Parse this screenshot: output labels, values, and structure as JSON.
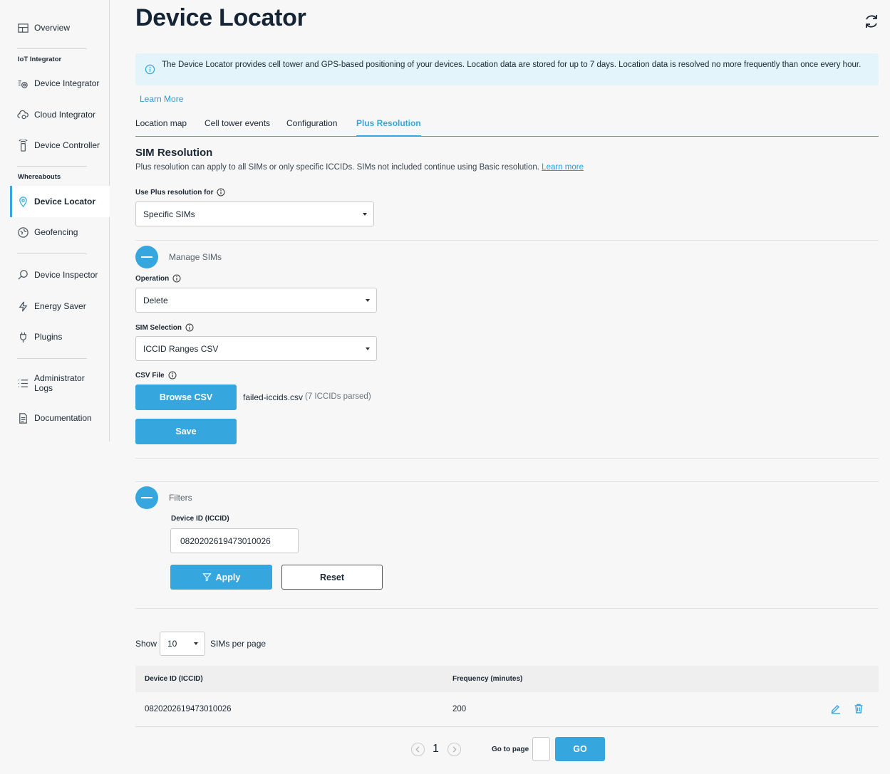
{
  "sidebar": {
    "overview": "Overview",
    "section_iot": "IoT Integrator",
    "device_integrator": "Device Integrator",
    "cloud_integrator": "Cloud Integrator",
    "device_controller": "Device Controller",
    "section_whereabouts": "Whereabouts",
    "device_locator": "Device Locator",
    "geofencing": "Geofencing",
    "device_inspector": "Device Inspector",
    "energy_saver": "Energy Saver",
    "plugins": "Plugins",
    "administrator_logs_line1": "Administrator",
    "administrator_logs_line2": "Logs",
    "documentation": "Documentation"
  },
  "header": {
    "title": "Device Locator"
  },
  "banner": {
    "text": "The Device Locator provides cell tower and GPS-based positioning of your devices. Location data are stored for up to 7 days. Location data is resolved no more frequently than once every hour.",
    "learn_more": "Learn More"
  },
  "tabs": [
    {
      "label": "Location map"
    },
    {
      "label": "Cell tower events"
    },
    {
      "label": "Configuration"
    },
    {
      "label": "Plus Resolution"
    }
  ],
  "sim_resolution": {
    "title": "SIM Resolution",
    "description": "Plus resolution can apply to all SIMs or only specific ICCIDs. SIMs not included continue using Basic resolution.",
    "learn_more": "Learn more",
    "use_plus_label": "Use Plus resolution for",
    "use_plus_value": "Specific SIMs"
  },
  "manage_sims": {
    "label": "Manage SIMs",
    "operation_label": "Operation",
    "operation_value": "Delete",
    "sim_selection_label": "SIM Selection",
    "sim_selection_value": "ICCID Ranges CSV",
    "csv_file_label": "CSV File",
    "browse_button": "Browse CSV",
    "file_name": "failed-iccids.csv",
    "file_note": "(7 ICCIDs parsed)",
    "save_button": "Save"
  },
  "filters": {
    "label": "Filters",
    "device_id_label": "Device ID (ICCID)",
    "device_id_value": "0820202619473010026",
    "apply_button": "Apply",
    "reset_button": "Reset"
  },
  "pagination_top": {
    "show_label": "Show",
    "per_page_value": "10",
    "suffix": "SIMs per page"
  },
  "table": {
    "columns": [
      "Device ID (ICCID)",
      "Frequency (minutes)"
    ],
    "rows": [
      {
        "device_id": "0820202619473010026",
        "frequency": "200"
      }
    ]
  },
  "pagination": {
    "current_page": "1",
    "goto_label": "Go to page",
    "go_button": "GO"
  },
  "colors": {
    "accent": "#36a6de",
    "banner_bg": "#e3f4fb",
    "text": "#1b2733"
  }
}
